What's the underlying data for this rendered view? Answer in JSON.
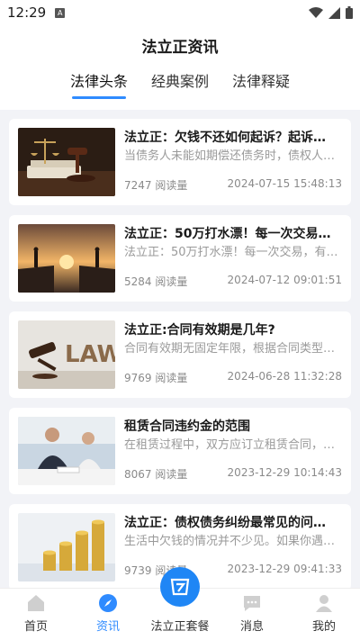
{
  "status": {
    "time": "12:29",
    "sim_label": "A"
  },
  "header": {
    "title": "法立正资讯"
  },
  "tabs": [
    {
      "label": "法律头条",
      "active": true
    },
    {
      "label": "经典案例",
      "active": false
    },
    {
      "label": "法律释疑",
      "active": false
    }
  ],
  "articles": [
    {
      "title": "法立正：欠钱不还如何起诉？起诉…",
      "summary": "当债务人未能如期偿还债务时，债权人…",
      "reads": "7247 阅读量",
      "date": "2024-07-15 15:48:13",
      "image": "gavel-scale-icon"
    },
    {
      "title": "法立正：50万打水漂！每一次交易…",
      "summary": "法立正：50万打水漂！每一次交易，有…",
      "reads": "5284 阅读量",
      "date": "2024-07-12 09:01:51",
      "image": "sunset-silhouette-icon"
    },
    {
      "title": "法立正:合同有效期是几年?",
      "summary": "合同有效期无固定年限，根据合同类型…",
      "reads": "9769 阅读量",
      "date": "2024-06-28 11:32:28",
      "image": "law-gavel-icon"
    },
    {
      "title": "租赁合同违约金的范围",
      "summary": "在租赁过程中，双方应订立租赁合同，…",
      "reads": "8067 阅读量",
      "date": "2023-12-29 10:14:43",
      "image": "business-meeting-icon"
    },
    {
      "title": "法立正：债权债务纠纷最常见的问…",
      "summary": "生活中欠钱的情况并不少见。如果你遇…",
      "reads": "9739 阅读量",
      "date": "2023-12-29 09:41:33",
      "image": "coin-stacks-icon"
    }
  ],
  "nav": [
    {
      "label": "首页",
      "icon": "home-icon",
      "active": false
    },
    {
      "label": "资讯",
      "icon": "compass-icon",
      "active": true
    },
    {
      "label": "法立正套餐",
      "icon": "package-icon",
      "active": false
    },
    {
      "label": "消息",
      "icon": "message-icon",
      "active": false
    },
    {
      "label": "我的",
      "icon": "profile-icon",
      "active": false
    }
  ],
  "colors": {
    "accent": "#2f8bff",
    "background": "#f2f3f7"
  }
}
